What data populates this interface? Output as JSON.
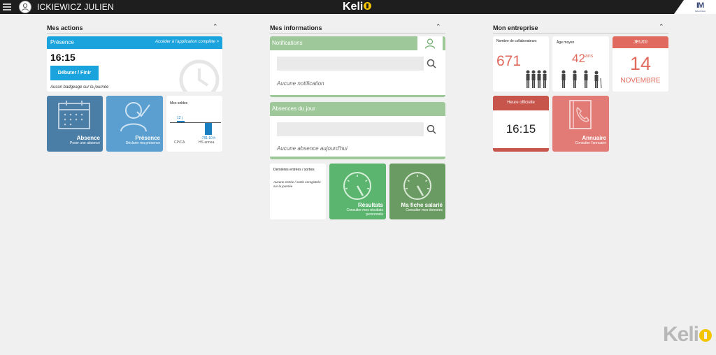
{
  "header": {
    "user_name": "ICKIEWICZ JULIEN",
    "brand": "Keli",
    "company_logo": "IM",
    "company_sub": "MALONGA"
  },
  "actions": {
    "title": "Mes actions",
    "presence_card": {
      "label": "Présence",
      "link": "Accéder à l'application complète  >",
      "time": "16:15",
      "button": "Débuter / Finir",
      "note": "Aucun badgeage sur la journée"
    },
    "absence_tile": {
      "title": "Absence",
      "subtitle": "Poser une absence"
    },
    "presence_tile": {
      "title": "Présence",
      "subtitle": "Déclarer ma présence"
    },
    "soldes": {
      "title": "Mes soldes",
      "items": [
        {
          "value_label": "12 j",
          "name": "CP/CA"
        },
        {
          "value_label": "-781:10 h",
          "name": "HS annua."
        }
      ]
    }
  },
  "infos": {
    "title": "Mes informations",
    "notifications": {
      "label": "Notifications",
      "empty": "Aucune notification"
    },
    "absences": {
      "label": "Absences du jour",
      "empty": "Aucune absence aujourd'hui"
    },
    "entries": {
      "title": "Dernières entrées / sorties",
      "empty": "Aucune entrée / sortie enregistrée sur la journée"
    },
    "resultats": {
      "title": "Résultats",
      "subtitle": "Consulter mes résultats personnels"
    },
    "fiche": {
      "title": "Ma fiche salarié",
      "subtitle": "Consulter mes données"
    }
  },
  "entreprise": {
    "title": "Mon entreprise",
    "collaborateurs": {
      "label": "Nombre de collaborateurs",
      "value": "671"
    },
    "age": {
      "label": "Âge moyen",
      "value": "42",
      "unit": "ans"
    },
    "date": {
      "day": "JEUDI",
      "number": "14",
      "month": "NOVEMBRE"
    },
    "heure": {
      "label": "Heure officielle",
      "time": "16:15"
    },
    "annuaire": {
      "title": "Annuaire",
      "subtitle": "Consulter l'annuaire"
    }
  },
  "footer": {
    "watermark": "Keli"
  },
  "colors": {
    "topbar": "#1e1e1e",
    "blue_header": "#1aa3dd",
    "absence_tile": "#4a7ea6",
    "presence_tile": "#5a9fcf",
    "green_header": "#9fc89a",
    "resultats_tile": "#5bb56f",
    "fiche_tile": "#6a9b62",
    "red_header": "#e06a5e",
    "red_value": "#e06a5e",
    "annuaire_tile": "#e27a76",
    "brand_yellow": "#f4c400"
  }
}
